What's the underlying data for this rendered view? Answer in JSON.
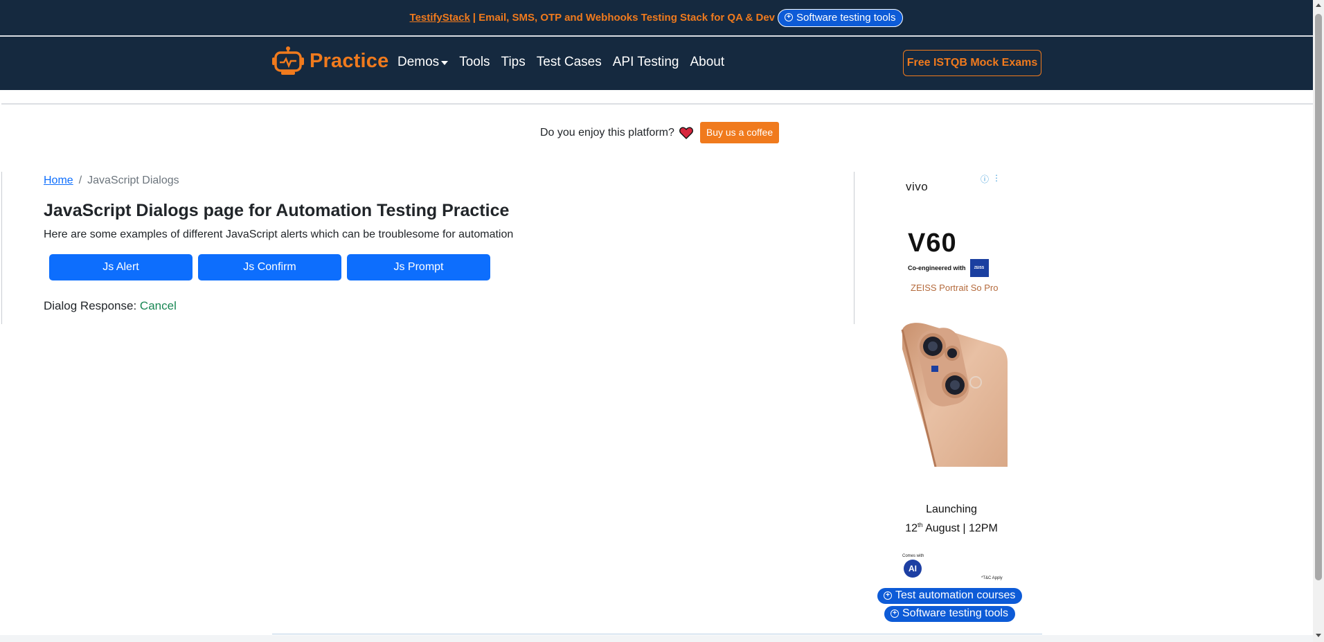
{
  "banner": {
    "link": "TestifyStack",
    "text": " | Email, SMS, OTP and Webhooks Testing Stack for QA & Dev",
    "pill": "Software testing tools"
  },
  "nav": {
    "brand": "Practice",
    "links": [
      "Demos",
      "Tools",
      "Tips",
      "Test Cases",
      "API Testing",
      "About"
    ],
    "cta": "Free ISTQB Mock Exams"
  },
  "coffee": {
    "question": "Do you enjoy this platform?",
    "button": "Buy us a coffee"
  },
  "breadcrumb": {
    "home": "Home",
    "separator": "/",
    "current": "JavaScript Dialogs"
  },
  "main": {
    "title": "JavaScript Dialogs page for Automation Testing Practice",
    "description": "Here are some examples of different JavaScript alerts which can be troublesome for automation",
    "buttons": [
      "Js Alert",
      "Js Confirm",
      "Js Prompt"
    ],
    "response_label": "Dialog Response: ",
    "response_value": "Cancel"
  },
  "ad": {
    "brand": "vivo",
    "model": "V60",
    "co_engineered": "Co-engineered with",
    "zeiss": "ZEISS",
    "tagline": "ZEISS Portrait So Pro",
    "launch_line1": "Launching",
    "launch_day": "12",
    "launch_suffix": "th",
    "launch_rest": " August  |  12PM",
    "ai_label": "Comes with",
    "ai": "AI",
    "tc": "*T&C Apply"
  },
  "floating": {
    "courses": "Test automation courses",
    "tools": "Software testing tools"
  },
  "colors": {
    "navy": "#15293f",
    "orange": "#f07a1d",
    "primary": "#0d6efd",
    "success": "#198754"
  }
}
